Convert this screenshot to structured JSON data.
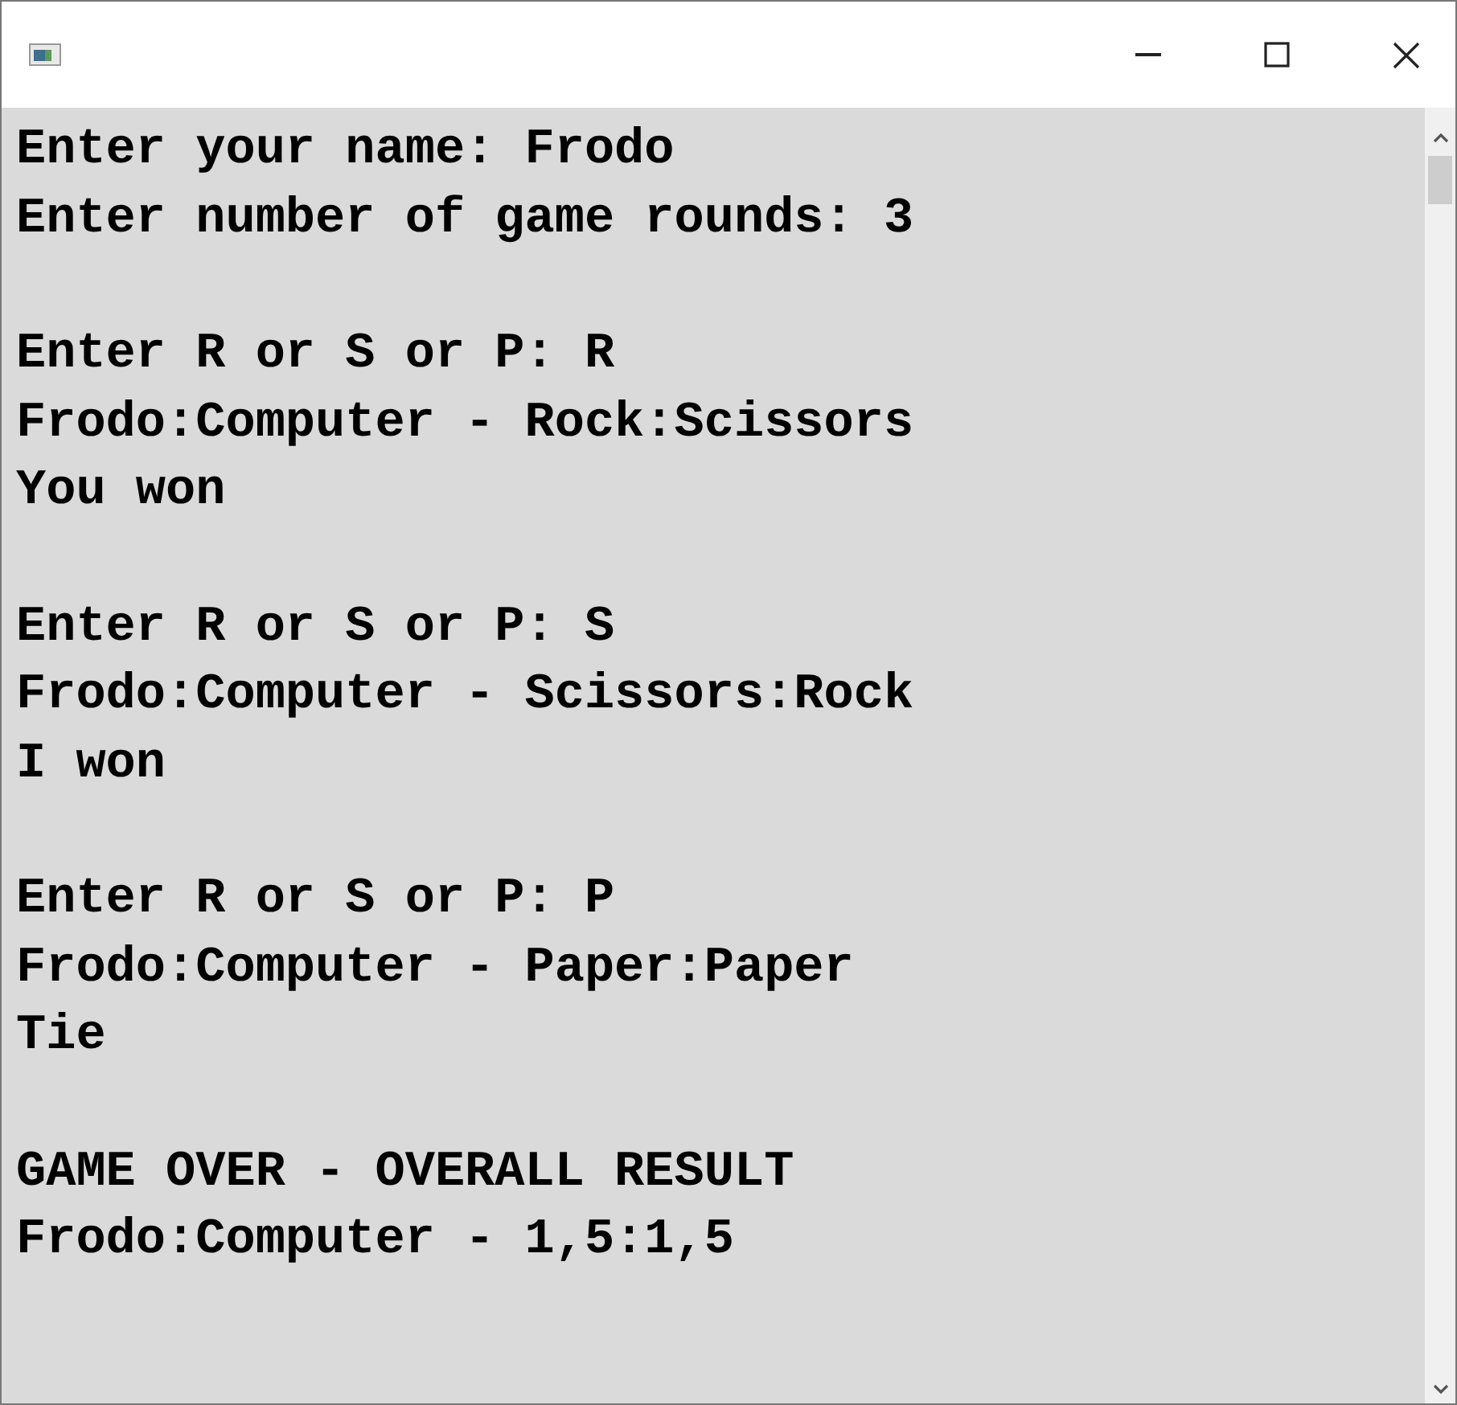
{
  "console": {
    "blocks": [
      {
        "lines": [
          "Enter your name: Frodo",
          "Enter number of game rounds: 3"
        ]
      },
      {
        "lines": [
          "Enter R or S or P: R",
          "Frodo:Computer - Rock:Scissors",
          "You won"
        ]
      },
      {
        "lines": [
          "Enter R or S or P: S",
          "Frodo:Computer - Scissors:Rock",
          "I won"
        ]
      },
      {
        "lines": [
          "Enter R or S or P: P",
          "Frodo:Computer - Paper:Paper",
          "Tie"
        ]
      },
      {
        "lines": [
          "GAME OVER - OVERALL RESULT",
          "Frodo:Computer - 1,5:1,5"
        ]
      }
    ]
  }
}
